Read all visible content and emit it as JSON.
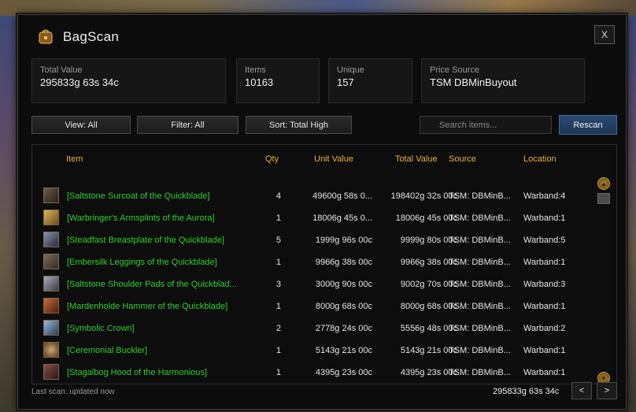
{
  "app": {
    "title": "BagScan",
    "close_label": "X"
  },
  "stats": [
    {
      "label": "Total Value",
      "value": "295833g 63s 34c"
    },
    {
      "label": "Items",
      "value": "10163"
    },
    {
      "label": "Unique",
      "value": "157"
    },
    {
      "label": "Price Source",
      "value": "TSM DBMinBuyout"
    }
  ],
  "toolbar": {
    "view_label": "View: All",
    "filter_label": "Filter: All",
    "sort_label": "Sort: Total High",
    "search_placeholder": "Search items...",
    "rescan_label": "Rescan"
  },
  "table": {
    "headers": {
      "item": "Item",
      "qty": "Qty",
      "unit": "Unit Value",
      "total": "Total Value",
      "source": "Source",
      "location": "Location"
    },
    "rows": [
      {
        "icon": "armor-chest-icon",
        "name": "[Saltstone Surcoat of the Quickblade]",
        "qty": "4",
        "unit": "49600g 58s 0...",
        "total": "198402g 32s 00c",
        "source": "TSM: DBMinB...",
        "location": "Warband:4"
      },
      {
        "icon": "bracers-icon",
        "name": "[Warbringer's Armsplints of the Aurora]",
        "qty": "1",
        "unit": "18006g 45s 0...",
        "total": "18006g 45s 00c",
        "source": "TSM: DBMinB...",
        "location": "Warband:1"
      },
      {
        "icon": "breastplate-icon",
        "name": "[Steadfast Breastplate of the Quickblade]",
        "qty": "5",
        "unit": "1999g 96s 00c",
        "total": "9999g 80s 00c",
        "source": "TSM: DBMinB...",
        "location": "Warband:5"
      },
      {
        "icon": "leggings-icon",
        "name": "[Embersilk Leggings of the Quickblade]",
        "qty": "1",
        "unit": "9966g 38s 00c",
        "total": "9966g 38s 00c",
        "source": "TSM: DBMinB...",
        "location": "Warband:1"
      },
      {
        "icon": "shoulder-pads-icon",
        "name": "[Saltstone Shoulder Pads of the Quickblad...",
        "qty": "3",
        "unit": "3000g 90s 00c",
        "total": "9002g 70s 00c",
        "source": "TSM: DBMinB...",
        "location": "Warband:3"
      },
      {
        "icon": "hammer-icon",
        "name": "[Mardenholde Hammer of the Quickblade]",
        "qty": "1",
        "unit": "8000g 68s 00c",
        "total": "8000g 68s 00c",
        "source": "TSM: DBMinB...",
        "location": "Warband:1"
      },
      {
        "icon": "crown-icon",
        "name": "[Symbolic Crown]",
        "qty": "2",
        "unit": "2778g 24s 00c",
        "total": "5556g 48s 00c",
        "source": "TSM: DBMinB...",
        "location": "Warband:2"
      },
      {
        "icon": "buckler-icon",
        "name": "[Ceremonial Buckler]",
        "qty": "1",
        "unit": "5143g 21s 00c",
        "total": "5143g 21s 00c",
        "source": "TSM: DBMinB...",
        "location": "Warband:1"
      },
      {
        "icon": "hood-icon",
        "name": "[Stagalbog Hood of the Harmonious]",
        "qty": "1",
        "unit": "4395g 23s 00c",
        "total": "4395g 23s 00c",
        "source": "TSM: DBMinB...",
        "location": "Warband:1"
      }
    ]
  },
  "footer": {
    "status": "Last scan: updated now",
    "total": "295833g 63s 34c",
    "prev_label": "<",
    "next_label": ">"
  },
  "colors": {
    "item_name": "#2ed12e",
    "header": "#e8b13a",
    "accent": "#2a4a70"
  }
}
